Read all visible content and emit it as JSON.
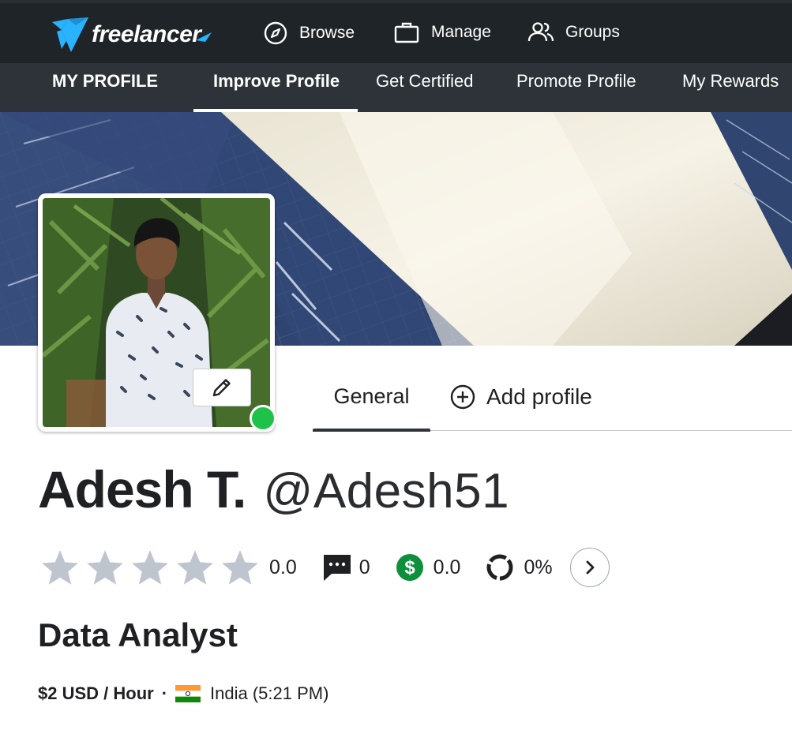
{
  "brand": {
    "name": "freelancer",
    "accent": "#29b2fe",
    "status_online": "#1ec24a"
  },
  "topnav": {
    "items": [
      {
        "label": "Browse",
        "icon": "compass-icon"
      },
      {
        "label": "Manage",
        "icon": "briefcase-icon"
      },
      {
        "label": "Groups",
        "icon": "users-icon"
      }
    ]
  },
  "subnav": {
    "items": [
      {
        "label": "MY PROFILE"
      },
      {
        "label": "Improve Profile",
        "active": true
      },
      {
        "label": "Get Certified"
      },
      {
        "label": "Promote Profile"
      },
      {
        "label": "My Rewards"
      }
    ]
  },
  "tabs": {
    "general": "General",
    "add_profile": "Add profile"
  },
  "profile": {
    "name": "Adesh T.",
    "username": "@Adesh51",
    "stats": {
      "rating": "0.0",
      "stars_filled": 0,
      "stars_total": 5,
      "reviews": "0",
      "earnings": "0.0",
      "completion": "0%"
    },
    "headline": "Data Analyst",
    "rate": "$2 USD / Hour",
    "separator": "·",
    "location": "India (5:21 PM)",
    "flag_icon": "india-flag-icon"
  }
}
